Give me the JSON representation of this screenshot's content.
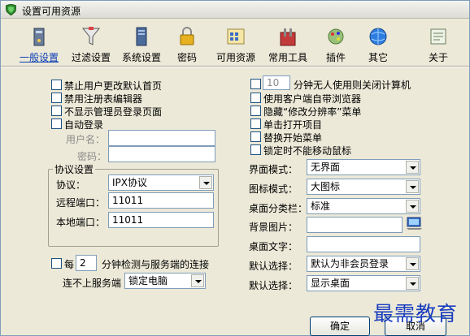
{
  "window": {
    "title": "设置可用资源"
  },
  "toolbar": {
    "items": [
      {
        "label": "一般设置",
        "icon": "general-settings-icon",
        "active": true
      },
      {
        "label": "过滤设置",
        "icon": "filter-settings-icon"
      },
      {
        "label": "系统设置",
        "icon": "system-settings-icon"
      },
      {
        "label": "密码",
        "icon": "lock-icon"
      },
      {
        "label": "可用资源",
        "icon": "resources-icon"
      },
      {
        "label": "常用工具",
        "icon": "tools-icon"
      },
      {
        "label": "插件",
        "icon": "plugin-icon"
      },
      {
        "label": "其它",
        "icon": "globe-icon"
      },
      {
        "label": "关于",
        "icon": "about-icon"
      }
    ]
  },
  "left": {
    "options": [
      "禁止用户更改默认首页",
      "禁用注册表编辑器",
      "不显示管理员登录页面",
      "自动登录"
    ],
    "username_label": "用户名：",
    "password_label": "密码：",
    "protocol_group": {
      "title": "协议设置",
      "protocol_label": "协议：",
      "protocol_value": "IPX协议",
      "remote_port_label": "远程端口：",
      "remote_port_value": "11011",
      "local_port_label": "本地端口：",
      "local_port_value": "11011"
    },
    "check_every_label": "每",
    "check_every_value": "2",
    "check_every_suffix": "分钟检测与服务端的连接",
    "disconnect_label": "连不上服务端",
    "disconnect_value": "锁定电脑"
  },
  "right": {
    "idle_value": "10",
    "idle_label": "分钟无人使用则关闭计算机",
    "options": [
      "使用客户端自带浏览器",
      "隐藏“修改分辨率”菜单",
      "单击打开项目",
      "替换开始菜单",
      "锁定时不能移动鼠标"
    ],
    "interface_mode_label": "界面模式：",
    "interface_mode_value": "无界面",
    "icon_mode_label": "图标模式：",
    "icon_mode_value": "大图标",
    "desktop_category_label": "桌面分类栏：",
    "desktop_category_value": "标准",
    "background_label": "背景图片：",
    "desktop_text_label": "桌面文字：",
    "default1_label": "默认选择：",
    "default1_value": "默认为非会员登录",
    "default2_label": "默认选择：",
    "default2_value": "显示桌面"
  },
  "buttons": {
    "ok": "确定",
    "cancel": "取消"
  },
  "watermark": "最需教育"
}
